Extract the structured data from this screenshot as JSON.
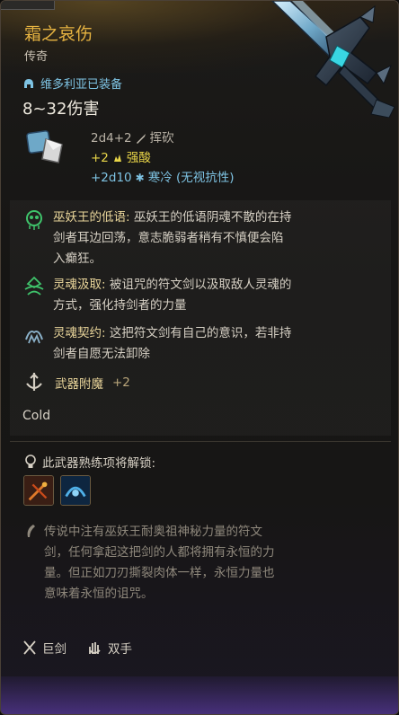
{
  "item": {
    "name": "霜之哀伤",
    "rarity": "传奇",
    "equipped_by": "维多利亚已装备",
    "damage": "8~32伤害"
  },
  "damage_rolls": {
    "base": "2d4+2",
    "base_type": "挥砍",
    "acid_bonus": "+2",
    "acid_type": "强酸",
    "cold_bonus": "+2d10",
    "cold_type": "寒冷 (无视抗性)"
  },
  "passives": [
    {
      "title": "巫妖王的低语:",
      "body": " 巫妖王的低语阴魂不散的在持剑者耳边回荡，意志脆弱者稍有不慎便会陷入癫狂。",
      "icon": "skull-whisper-icon"
    },
    {
      "title": "灵魂汲取:",
      "body": " 被诅咒的符文剑以汲取敌人灵魂的方式，强化持剑者的力量",
      "icon": "soul-drain-icon"
    },
    {
      "title": "灵魂契约:",
      "body": " 这把符文剑有自己的意识，若非持剑者自愿无法卸除",
      "icon": "soul-pact-icon"
    }
  ],
  "enchant": {
    "label": "武器附魔",
    "value": "+2"
  },
  "enchant_element": "Cold",
  "proficiency": {
    "label": "此武器熟练项将解锁:"
  },
  "flavor_text": "传说中注有巫妖王耐奥祖神秘力量的符文剑，任何拿起这把剑的人都将拥有永恒的力量。但正如刀刃撕裂肉体一样，永恒力量也意味着永恒的诅咒。",
  "tags": [
    {
      "label": "巨剑",
      "icon": "greatsword-icon"
    },
    {
      "label": "双手",
      "icon": "two-handed-icon"
    }
  ],
  "colors": {
    "legendary": "#e6b341",
    "equipped": "#7ec3e3",
    "acid": "#e8d548",
    "cold": "#7ec3e3",
    "passive_title": "#e9d59a"
  }
}
